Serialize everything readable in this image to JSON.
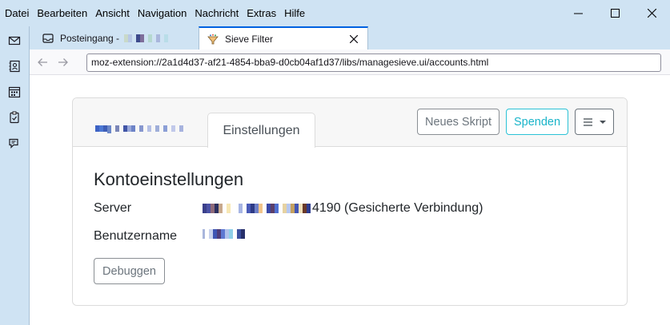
{
  "menubar": {
    "items": [
      "Datei",
      "Bearbeiten",
      "Ansicht",
      "Navigation",
      "Nachricht",
      "Extras",
      "Hilfe"
    ]
  },
  "tabs": [
    {
      "title": "Posteingang -",
      "icon": "inbox-icon",
      "active": false
    },
    {
      "title": "Sieve Filter",
      "icon": "sieve-icon",
      "active": true
    }
  ],
  "address_bar": {
    "url": "moz-extension://2a1d4d37-af21-4854-bba9-d0cb04af1d37/libs/managesieve.ui/accounts.html"
  },
  "card": {
    "settings_tab_label": "Einstellungen",
    "new_script_label": "Neues Skript",
    "donate_label": "Spenden",
    "menu_label": "☰ ▾"
  },
  "account": {
    "heading": "Kontoeinstellungen",
    "server_label": "Server",
    "server_value_suffix": "4190 (Gesicherte Verbindung)",
    "username_label": "Benutzername",
    "debug_label": "Debuggen"
  },
  "colors": {
    "accent_blue": "#0061e0",
    "donate_teal": "#19b4c9",
    "chrome_bg": "#cfe3f3"
  }
}
